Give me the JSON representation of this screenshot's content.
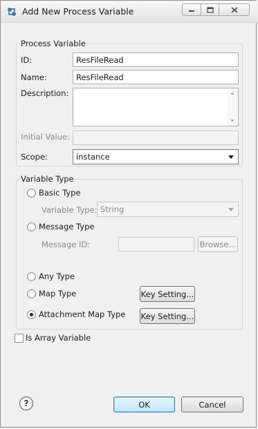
{
  "window": {
    "title": "Add New Process Variable"
  },
  "process_variable": {
    "group_title": "Process Variable",
    "id_label": "ID:",
    "id_value": "ResFileRead",
    "name_label": "Name:",
    "name_value": "ResFileRead",
    "description_label": "Description:",
    "description_value": "",
    "initial_value_label": "Initial Value:",
    "initial_value_value": "",
    "scope_label": "Scope:",
    "scope_value": "instance"
  },
  "variable_type": {
    "group_title": "Variable Type",
    "basic_type_label": "Basic Type",
    "variable_type_label": "Variable Type:",
    "variable_type_value": "String",
    "message_type_label": "Message Type",
    "message_id_label": "Message ID:",
    "message_id_value": "",
    "browse_label": "Browse...",
    "any_type_label": "Any Type",
    "map_type_label": "Map Type",
    "map_key_setting_label": "Key Setting...",
    "attachment_map_type_label": "Attachment Map Type",
    "attachment_key_setting_label": "Key Setting...",
    "selected": "Attachment Map Type"
  },
  "is_array": {
    "label": "Is Array Variable",
    "checked": false
  },
  "footer": {
    "ok_label": "OK",
    "cancel_label": "Cancel"
  },
  "colors": {
    "default_button_border": "#3c7fb1",
    "group_border": "#d5d5d5",
    "background": "#f0f0f0"
  }
}
